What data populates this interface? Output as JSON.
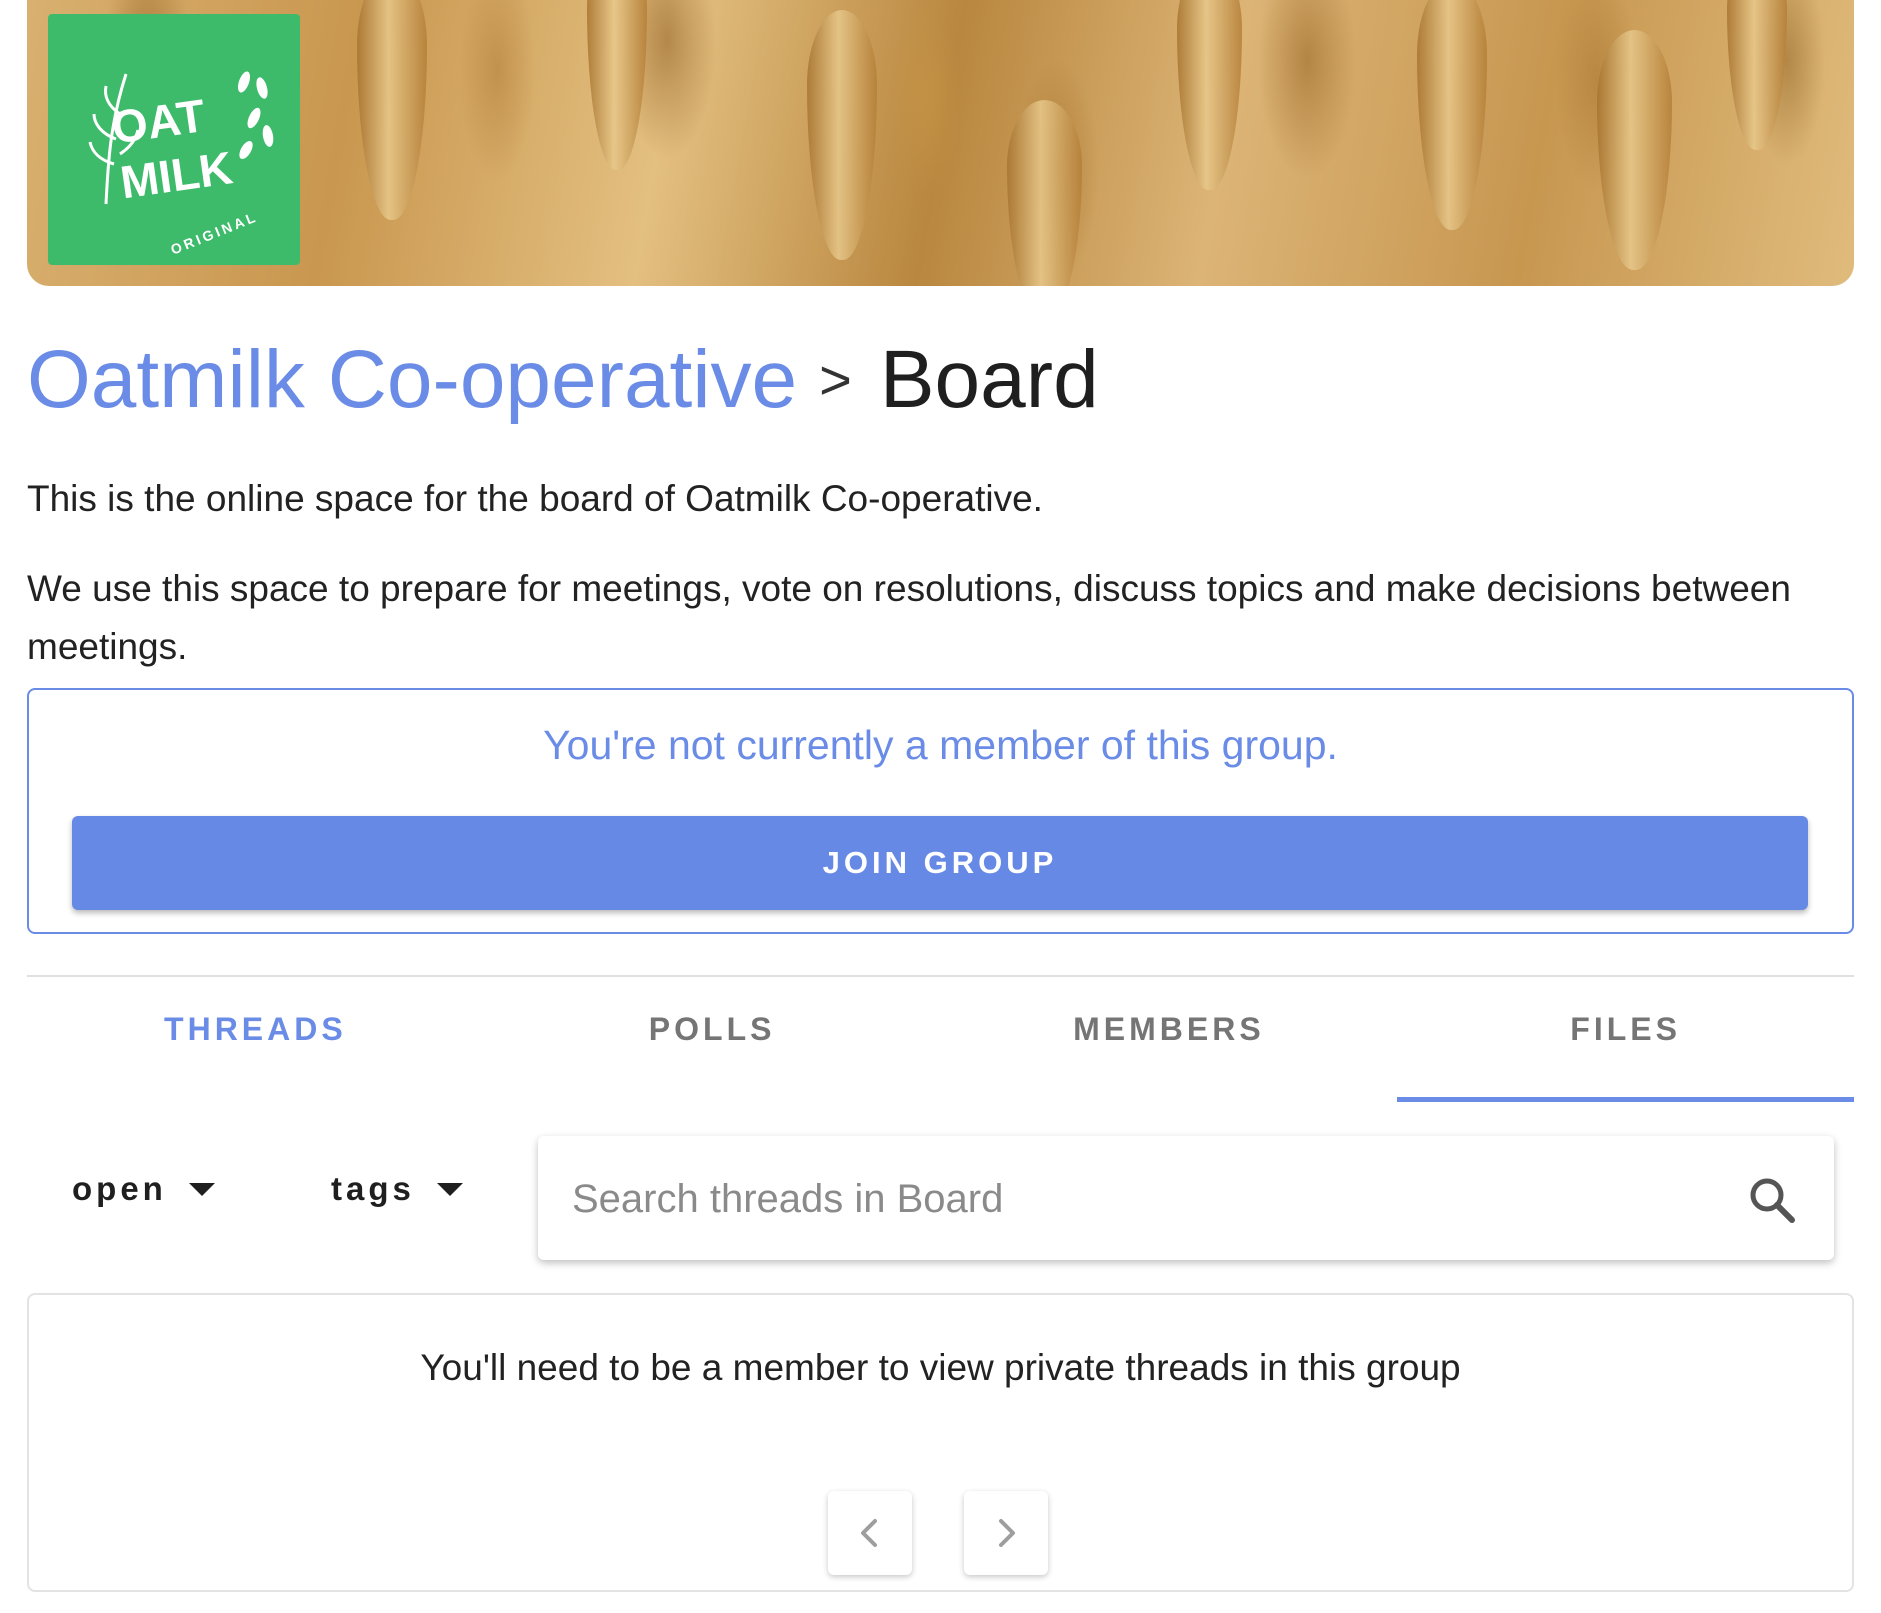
{
  "group": {
    "parent_name": "Oatmilk Co-operative",
    "separator": ">",
    "name": "Board",
    "description_1": "This is the online space for the board of Oatmilk Co-operative.",
    "description_2": "We use this space to prepare for meetings, vote on resolutions, discuss topics and make decisions between meetings."
  },
  "logo": {
    "line1": "OAT",
    "line2": "MILK",
    "line3": "ORIGINAL",
    "background": "#3dbb6b"
  },
  "membership": {
    "message": "You're not currently a member of this group.",
    "join_label": "JOIN GROUP"
  },
  "tabs": [
    {
      "label": "THREADS",
      "active": true
    },
    {
      "label": "POLLS",
      "active": false
    },
    {
      "label": "MEMBERS",
      "active": false
    },
    {
      "label": "FILES",
      "active": false,
      "underlined": true
    }
  ],
  "filters": {
    "status_label": "open",
    "tags_label": "tags"
  },
  "search": {
    "placeholder": "Search threads in Board",
    "value": ""
  },
  "threads": {
    "notice": "You'll need to be a member to view private threads in this group"
  },
  "pagination": {
    "prev_icon": "chevron-left-icon",
    "next_icon": "chevron-right-icon"
  },
  "colors": {
    "accent": "#6a8ce6",
    "button": "#6789e6",
    "logo_green": "#3dbb6b"
  }
}
